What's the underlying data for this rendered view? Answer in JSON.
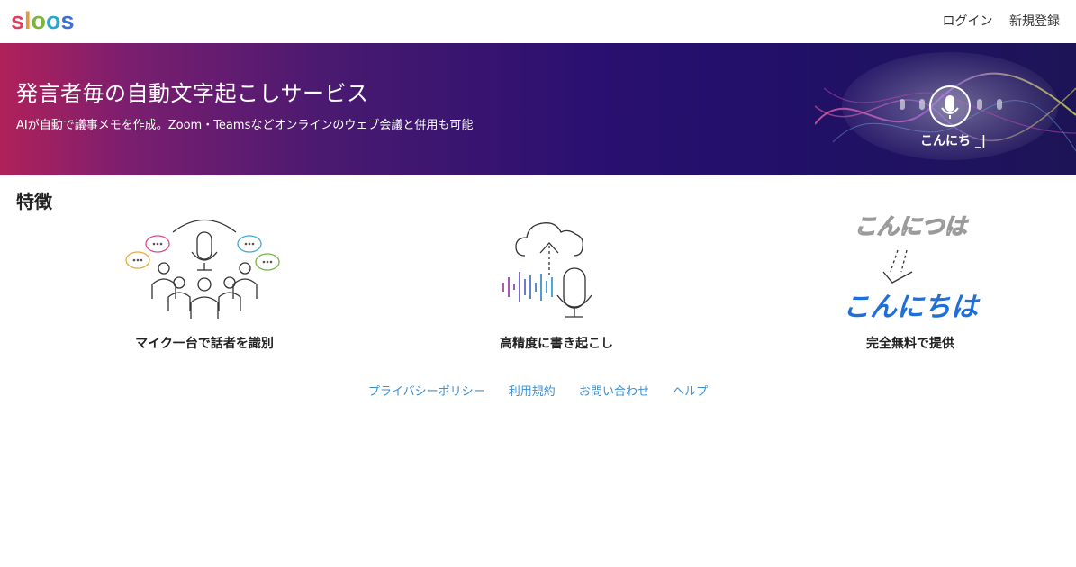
{
  "header": {
    "logo_text": "sloos",
    "login_label": "ログイン",
    "register_label": "新規登録"
  },
  "hero": {
    "title": "発言者毎の自動文字起こしサービス",
    "subtitle": "AIが自動で議事メモを作成。Zoom・Teamsなどオンラインのウェブ会議と併用も可能",
    "mic_caption": "こんにち _|"
  },
  "features": {
    "title": "特徴",
    "items": [
      {
        "label": "マイク一台で話者を識別",
        "icon": "speaker-identification-icon"
      },
      {
        "label": "高精度に書き起こし",
        "icon": "cloud-transcription-icon"
      },
      {
        "label": "完全無料で提供",
        "icon": "text-correction-icon",
        "before_text": "こんにつは",
        "after_text": "こんにちは"
      }
    ]
  },
  "footer": {
    "links": [
      "プライバシーポリシー",
      "利用規約",
      "お問い合わせ",
      "ヘルプ"
    ]
  },
  "colors": {
    "link": "#3d8fd0",
    "hero_left": "#b0215a",
    "hero_right": "#1d1457",
    "accent_blue": "#1e6fd9"
  }
}
